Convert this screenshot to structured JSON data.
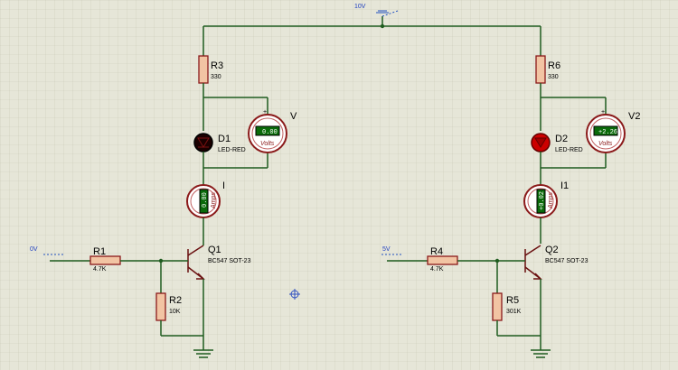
{
  "supply": {
    "label": "10V"
  },
  "left": {
    "input_label": "0V",
    "r1": {
      "name": "R1",
      "value": "4.7K"
    },
    "r2": {
      "name": "R2",
      "value": "10K"
    },
    "r3": {
      "name": "R3",
      "value": "330"
    },
    "led": {
      "name": "D1",
      "type": "LED-RED",
      "state": "off"
    },
    "transistor": {
      "name": "Q1",
      "type": "BC547 SOT-23"
    },
    "voltmeter": {
      "name": "V",
      "reading": "0.00",
      "unit": "Volts"
    },
    "ammeter": {
      "name": "I",
      "reading": "0.00",
      "unit": "Amps"
    }
  },
  "right": {
    "input_label": "5V",
    "r4": {
      "name": "R4",
      "value": "4.7K"
    },
    "r5": {
      "name": "R5",
      "value": "301K"
    },
    "r6": {
      "name": "R6",
      "value": "330"
    },
    "led": {
      "name": "D2",
      "type": "LED-RED",
      "state": "on"
    },
    "transistor": {
      "name": "Q2",
      "type": "BC547 SOT-23"
    },
    "voltmeter": {
      "name": "V2",
      "reading": "+2.26",
      "unit": "Volts"
    },
    "ammeter": {
      "name": "I1",
      "reading": "+0.02",
      "unit": "Amps"
    }
  },
  "colors": {
    "background": "#e6e6d8",
    "wire": "#1f5c1f",
    "component_outline": "#8b1a1a",
    "led_on": "#cc0000",
    "led_off": "#1a0000",
    "lcd": "#0a6a0a"
  }
}
